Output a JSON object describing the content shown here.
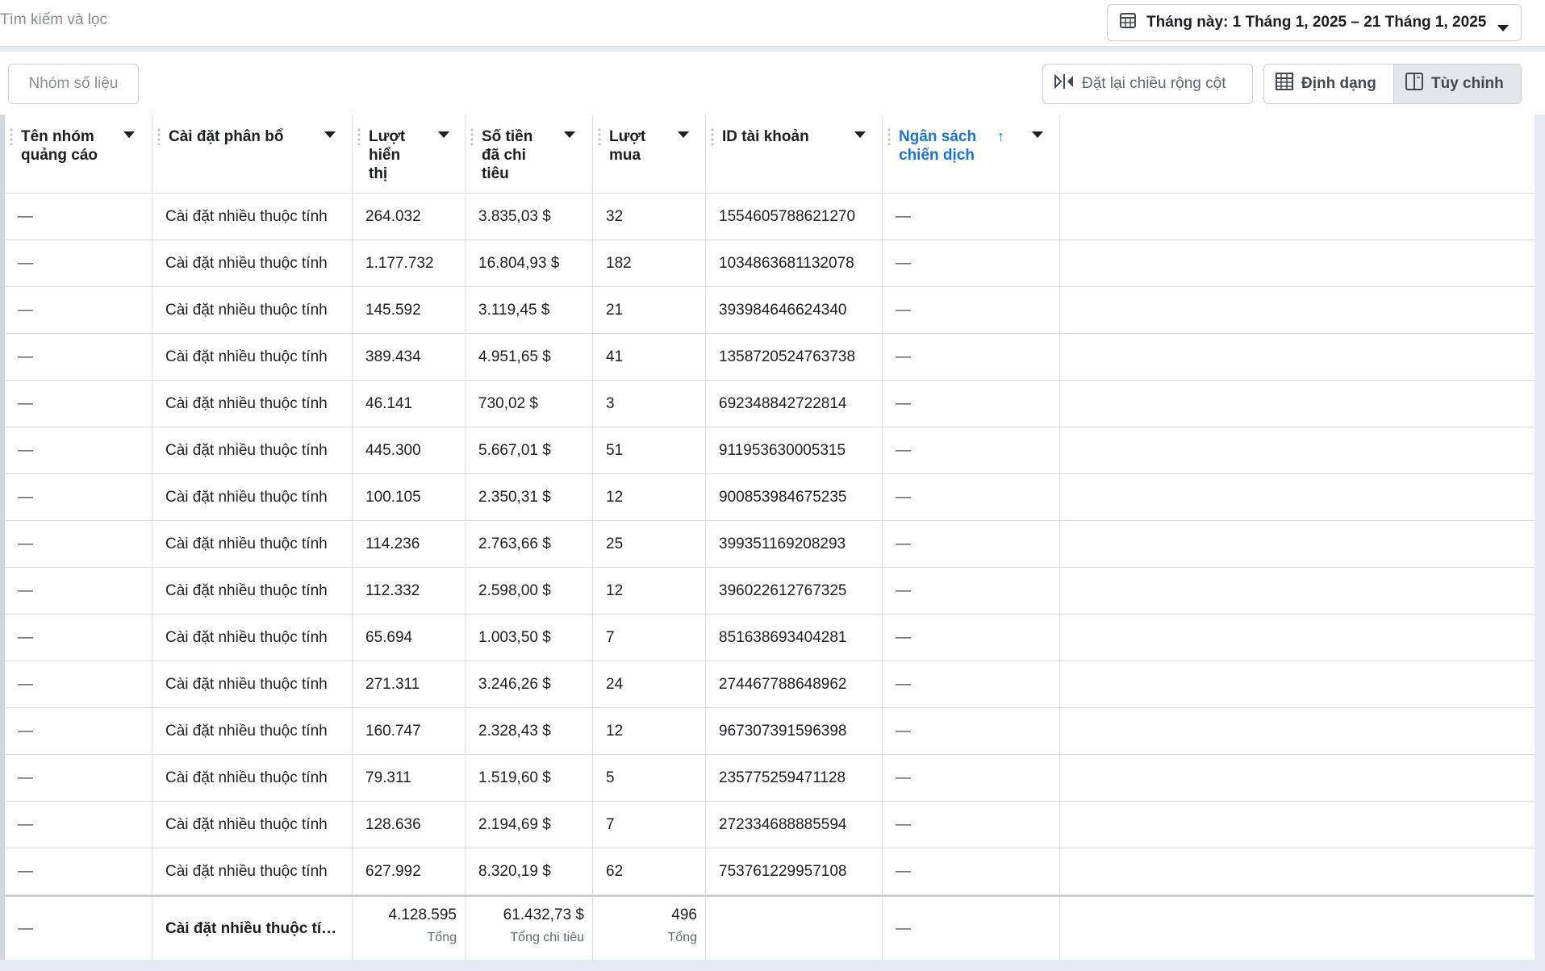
{
  "search": {
    "placeholder": "Tìm kiếm và lọc"
  },
  "date_range": {
    "label": "Tháng này: 1 Tháng 1, 2025 – 21 Tháng 1, 2025"
  },
  "toolbar": {
    "group_metrics": "Nhóm số liệu",
    "reset_width": "Đặt lại chiều rộng cột",
    "format": "Định dạng",
    "customize": "Tùy chỉnh"
  },
  "columns": [
    {
      "key": "adset",
      "line1": "Tên nhóm",
      "line2": "quảng cáo",
      "line3": ""
    },
    {
      "key": "attribution",
      "line1": "Cài đặt phân bổ",
      "line2": "",
      "line3": ""
    },
    {
      "key": "impressions",
      "line1": "Lượt",
      "line2": "hiển",
      "line3": "thị"
    },
    {
      "key": "spent",
      "line1": "Số tiền",
      "line2": "đã chi",
      "line3": "tiêu"
    },
    {
      "key": "purchases",
      "line1": "Lượt",
      "line2": "mua",
      "line3": ""
    },
    {
      "key": "account_id",
      "line1": "ID tài khoản",
      "line2": "",
      "line3": ""
    },
    {
      "key": "budget",
      "line1": "Ngân sách",
      "line2": "chiến dịch",
      "line3": ""
    }
  ],
  "rows": [
    {
      "adset": "—",
      "attribution": "Cài đặt nhiều thuộc tính",
      "impressions": "264.032",
      "spent": "3.835,03 $",
      "purchases": "32",
      "account_id": "1554605788621270",
      "budget": "—"
    },
    {
      "adset": "—",
      "attribution": "Cài đặt nhiều thuộc tính",
      "impressions": "1.177.732",
      "spent": "16.804,93 $",
      "purchases": "182",
      "account_id": "1034863681132078",
      "budget": "—"
    },
    {
      "adset": "—",
      "attribution": "Cài đặt nhiều thuộc tính",
      "impressions": "145.592",
      "spent": "3.119,45 $",
      "purchases": "21",
      "account_id": "393984646624340",
      "budget": "—"
    },
    {
      "adset": "—",
      "attribution": "Cài đặt nhiều thuộc tính",
      "impressions": "389.434",
      "spent": "4.951,65 $",
      "purchases": "41",
      "account_id": "1358720524763738",
      "budget": "—"
    },
    {
      "adset": "—",
      "attribution": "Cài đặt nhiều thuộc tính",
      "impressions": "46.141",
      "spent": "730,02 $",
      "purchases": "3",
      "account_id": "692348842722814",
      "budget": "—"
    },
    {
      "adset": "—",
      "attribution": "Cài đặt nhiều thuộc tính",
      "impressions": "445.300",
      "spent": "5.667,01 $",
      "purchases": "51",
      "account_id": "911953630005315",
      "budget": "—"
    },
    {
      "adset": "—",
      "attribution": "Cài đặt nhiều thuộc tính",
      "impressions": "100.105",
      "spent": "2.350,31 $",
      "purchases": "12",
      "account_id": "900853984675235",
      "budget": "—"
    },
    {
      "adset": "—",
      "attribution": "Cài đặt nhiều thuộc tính",
      "impressions": "114.236",
      "spent": "2.763,66 $",
      "purchases": "25",
      "account_id": "399351169208293",
      "budget": "—"
    },
    {
      "adset": "—",
      "attribution": "Cài đặt nhiều thuộc tính",
      "impressions": "112.332",
      "spent": "2.598,00 $",
      "purchases": "12",
      "account_id": "396022612767325",
      "budget": "—"
    },
    {
      "adset": "—",
      "attribution": "Cài đặt nhiều thuộc tính",
      "impressions": "65.694",
      "spent": "1.003,50 $",
      "purchases": "7",
      "account_id": "851638693404281",
      "budget": "—"
    },
    {
      "adset": "—",
      "attribution": "Cài đặt nhiều thuộc tính",
      "impressions": "271.311",
      "spent": "3.246,26 $",
      "purchases": "24",
      "account_id": "274467788648962",
      "budget": "—"
    },
    {
      "adset": "—",
      "attribution": "Cài đặt nhiều thuộc tính",
      "impressions": "160.747",
      "spent": "2.328,43 $",
      "purchases": "12",
      "account_id": "967307391596398",
      "budget": "—"
    },
    {
      "adset": "—",
      "attribution": "Cài đặt nhiều thuộc tính",
      "impressions": "79.311",
      "spent": "1.519,60 $",
      "purchases": "5",
      "account_id": "235775259471128",
      "budget": "—"
    },
    {
      "adset": "—",
      "attribution": "Cài đặt nhiều thuộc tính",
      "impressions": "128.636",
      "spent": "2.194,69 $",
      "purchases": "7",
      "account_id": "272334688885594",
      "budget": "—"
    },
    {
      "adset": "—",
      "attribution": "Cài đặt nhiều thuộc tính",
      "impressions": "627.992",
      "spent": "8.320,19 $",
      "purchases": "62",
      "account_id": "753761229957108",
      "budget": "—"
    }
  ],
  "totals": {
    "adset": "—",
    "attribution": "Cài đặt nhiều thuộc tí…",
    "impressions": "4.128.595",
    "impressions_label": "Tổng",
    "spent": "61.432,73 $",
    "spent_label": "Tổng chi tiêu",
    "purchases": "496",
    "purchases_label": "Tổng",
    "account_id": "",
    "budget": "—"
  }
}
